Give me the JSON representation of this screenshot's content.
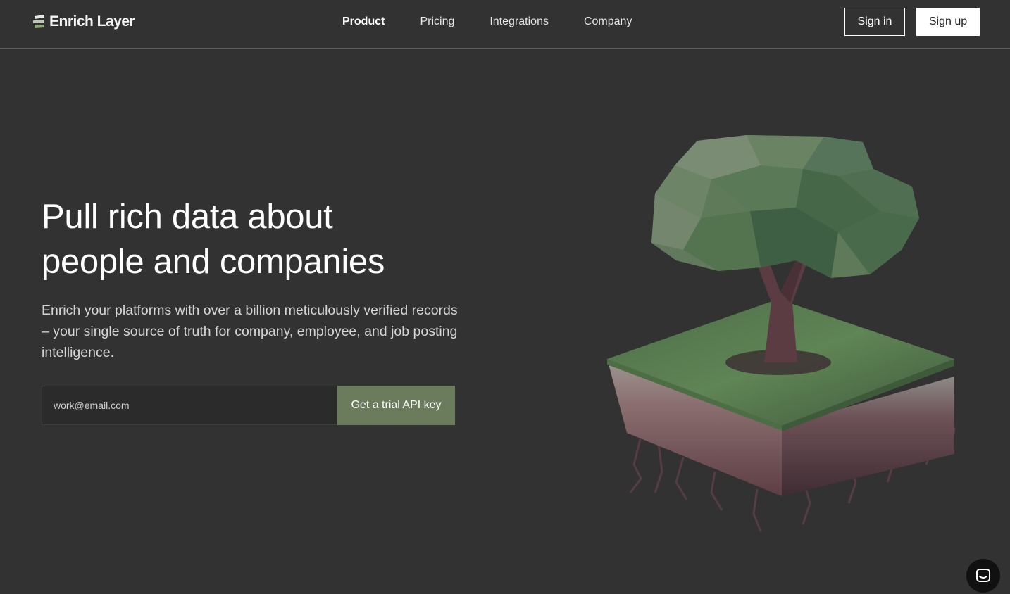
{
  "brand": {
    "name": "Enrich Layer",
    "logo_icon": "stacked-layers-icon"
  },
  "nav": {
    "links": [
      {
        "label": "Product",
        "active": true
      },
      {
        "label": "Pricing",
        "active": false
      },
      {
        "label": "Integrations",
        "active": false
      },
      {
        "label": "Company",
        "active": false
      }
    ],
    "signin_label": "Sign in",
    "signup_label": "Sign up"
  },
  "hero": {
    "headline_line1": "Pull rich data about",
    "headline_line2": "people and companies",
    "subheading": "Enrich your platforms with over a billion meticulously verified records – your single source of truth for company, employee, and job posting intelligence.",
    "email_placeholder": "work@email.com",
    "email_value": "",
    "cta_label": "Get a trial API key",
    "illustration": "low-poly-tree-on-soil-block"
  },
  "chat": {
    "icon": "chat-bubble-icon"
  },
  "colors": {
    "background": "#323232",
    "accent": "#6b7c5c",
    "text": "#ffffff",
    "muted_text": "#d6d6d6"
  }
}
